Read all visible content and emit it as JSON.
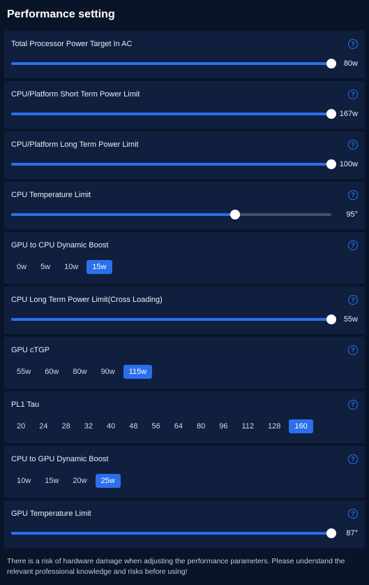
{
  "title": "Performance setting",
  "help_glyph": "?",
  "sections": [
    {
      "type": "slider",
      "label": "Total Processor Power Target In AC",
      "value_text": "80w",
      "fill_pct": 100
    },
    {
      "type": "slider",
      "label": "CPU/Platform Short Term Power Limit",
      "value_text": "167w",
      "fill_pct": 100
    },
    {
      "type": "slider",
      "label": "CPU/Platform Long Term Power Limit",
      "value_text": "100w",
      "fill_pct": 100
    },
    {
      "type": "slider",
      "label": "CPU Temperature Limit",
      "value_text": "95°",
      "fill_pct": 70
    },
    {
      "type": "chips",
      "label": "GPU to CPU Dynamic Boost",
      "options": [
        "0w",
        "5w",
        "10w",
        "15w"
      ],
      "selected": 3
    },
    {
      "type": "slider",
      "label": "CPU Long Term Power Limit(Cross Loading)",
      "value_text": "55w",
      "fill_pct": 100
    },
    {
      "type": "chips",
      "label": "GPU cTGP",
      "options": [
        "55w",
        "60w",
        "80w",
        "90w",
        "115w"
      ],
      "selected": 4
    },
    {
      "type": "chips",
      "label": "PL1 Tau",
      "options": [
        "20",
        "24",
        "28",
        "32",
        "40",
        "48",
        "56",
        "64",
        "80",
        "96",
        "112",
        "128",
        "160"
      ],
      "selected": 12
    },
    {
      "type": "chips",
      "label": "CPU to GPU Dynamic Boost",
      "options": [
        "10w",
        "15w",
        "20w",
        "25w"
      ],
      "selected": 3
    },
    {
      "type": "slider",
      "label": "GPU Temperature Limit",
      "value_text": "87°",
      "fill_pct": 100
    }
  ],
  "warning": "There is a risk of hardware damage when adjusting the performance parameters. Please understand the relevant professional knowledge and risks before using!"
}
